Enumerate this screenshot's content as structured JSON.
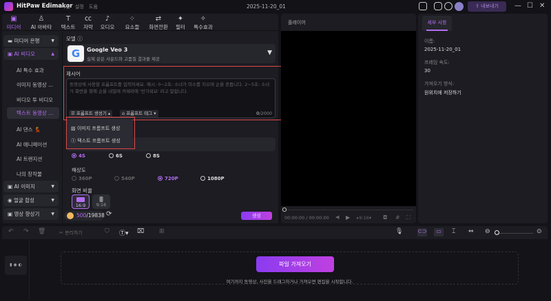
{
  "app": {
    "name": "HitPaw Edimakor",
    "menu": [
      "파일",
      "설정",
      "도움"
    ],
    "document": "2025-11-20_01",
    "export": "내보내기"
  },
  "tabs": [
    {
      "label": "미디어",
      "icon": "media-icon"
    },
    {
      "label": "AI 아바타",
      "icon": "avatar-icon"
    },
    {
      "label": "텍스트",
      "icon": "text-icon"
    },
    {
      "label": "자막",
      "icon": "caption-icon"
    },
    {
      "label": "오디오",
      "icon": "audio-icon"
    },
    {
      "label": "요소들",
      "icon": "elements-icon"
    },
    {
      "label": "화면전환",
      "icon": "transition-icon"
    },
    {
      "label": "필터",
      "icon": "filter-icon"
    },
    {
      "label": "특수효과",
      "icon": "effects-icon"
    }
  ],
  "sidebar": {
    "media_library": "미디어 은행",
    "ai_video": "AI 비디오",
    "sub": [
      "AI 특수 효과",
      "이미지 동영상 ...",
      "비디오 투 비디오",
      "텍스트 동영상 ...",
      "AI 댄스 💃",
      "AI 애니메이션",
      "AI 트랜지션",
      "나의 창작물"
    ],
    "ai_image": "AI 이미지",
    "face": "얼굴 합성",
    "enhancer": "영상 향상기"
  },
  "model": {
    "label": "모델",
    "name": "Google Veo 3",
    "desc": "실제 같은 사운드와 고품질 결과물 제공"
  },
  "prompt": {
    "label": "제시어",
    "placeholder": "동영상에 사용할 프롬프트를 입력하세요. 예시: 0~2초: 소녀가 미소를 지으며 손을 흔듭니다. 2~5초: 소녀가 화면을 향해 손을 내밀며 카메라에 '반가워요' 라고 말합니다.",
    "generator": "프롬프트 생성기",
    "tag": "프롬프트 태그",
    "count": "0",
    "max": "/2000"
  },
  "dropdown": [
    "이미지 프롬프트 생성",
    "텍스트 프롬프트 생성"
  ],
  "duration": {
    "options": [
      "4S",
      "6S",
      "8S"
    ],
    "selected": "4S"
  },
  "resolution": {
    "label": "해상도",
    "options": [
      "360P",
      "540P",
      "720P",
      "1080P"
    ],
    "selected": "720P"
  },
  "aspect": {
    "label": "화면 비율",
    "options": [
      "16:9",
      "9:16"
    ]
  },
  "credits": {
    "used": "500",
    "total": "/19838"
  },
  "generate": "생성",
  "player": {
    "label": "플레이어",
    "time": "00:00:00",
    "duration": "/ 00:00:00",
    "ratio": "9:16"
  },
  "details": {
    "tab": "세부 사항",
    "name_label": "이름:",
    "name": "2025-11-20_01",
    "fps_label": "프레임 속도:",
    "fps": "30",
    "import_label": "가져오기 방식:",
    "import": "원위치에 저장하기"
  },
  "timeline": {
    "split": "분리하기",
    "import_button": "파일 가져오기",
    "hint": "여기까지 동영상, 사진을 드래그하거나 가져오면 편집을 시작합니다."
  },
  "colors": {
    "accent": "#b36df0",
    "highlight": "#e04848"
  }
}
